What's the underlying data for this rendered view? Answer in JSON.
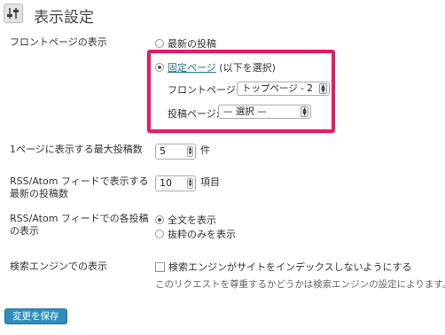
{
  "header": {
    "title": "表示設定",
    "icon": "settings-sliders-icon"
  },
  "front_page": {
    "label": "フロントページの表示",
    "option_latest": "最新の投稿",
    "option_static": "固定ページ",
    "option_static_note": "(以下を選択)",
    "front_label": "フロントページ:",
    "front_value": "トップページ - 2",
    "posts_label": "投稿ページ:",
    "posts_value": "— 選択 —",
    "selected": "static"
  },
  "posts_per_page": {
    "label": "1ページに表示する最大投稿数",
    "value": "5",
    "unit": "件"
  },
  "feed_count": {
    "label_line1": "RSS/Atom フィードで表示する",
    "label_line2": "最新の投稿数",
    "value": "10",
    "unit": "項目"
  },
  "feed_content": {
    "label_line1": "RSS/Atom フィードでの各投稿",
    "label_line2": "の表示",
    "option_full": "全文を表示",
    "option_summary": "抜粋のみを表示",
    "selected": "full"
  },
  "search_engine": {
    "label": "検索エンジンでの表示",
    "checkbox_label": "検索エンジンがサイトをインデックスしないようにする",
    "description": "このリクエストを尊重するかどうかは検索エンジンの設定によります。",
    "checked": false
  },
  "save_button": "変更を保存",
  "colors": {
    "highlight": "#e8196a",
    "primary_button": "#2e8fbf",
    "link": "#21759b"
  }
}
